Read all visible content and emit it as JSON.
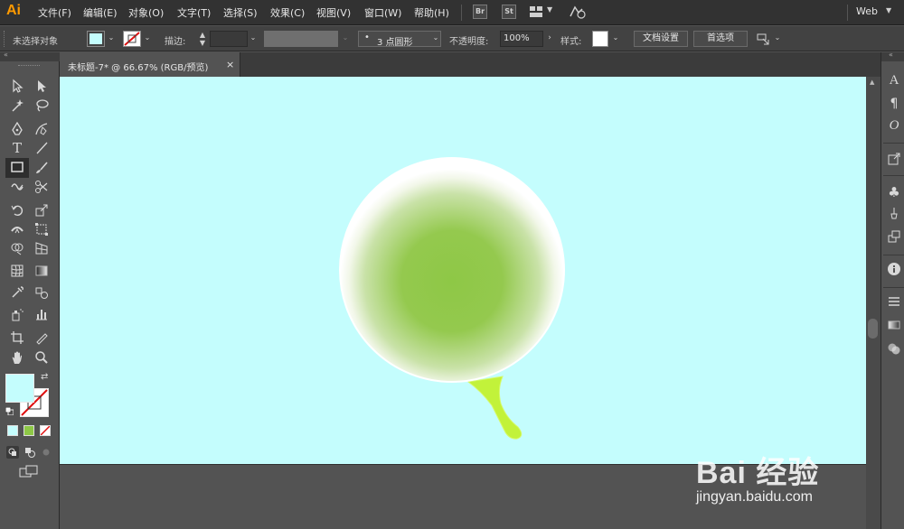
{
  "app": {
    "logo": "Ai",
    "workspace": "Web"
  },
  "menu": [
    {
      "label": "文件(F)"
    },
    {
      "label": "编辑(E)"
    },
    {
      "label": "对象(O)"
    },
    {
      "label": "文字(T)"
    },
    {
      "label": "选择(S)"
    },
    {
      "label": "效果(C)"
    },
    {
      "label": "视图(V)"
    },
    {
      "label": "窗口(W)"
    },
    {
      "label": "帮助(H)"
    }
  ],
  "app_buttons": {
    "bridge": "Br",
    "stock": "St"
  },
  "control": {
    "selection_status": "未选择对象",
    "stroke_label": "描边",
    "brush_label": "3 点圆形",
    "opacity_label": "不透明度",
    "opacity_value": "100%",
    "style_label": "样式",
    "doc_setup_button": "文档设置",
    "prefs_button": "首选项"
  },
  "document_tab": {
    "title": "未标题-7* @ 66.67% (RGB/预览)",
    "close": "×"
  },
  "colors": {
    "artboard": "#c4fdfd",
    "fill_swatch": "#c4fdfd",
    "balloon_center": "#8ec846",
    "tail": "#c2f23a"
  },
  "watermark": {
    "brand": "Bai 经验",
    "url": "jingyan.baidu.com"
  }
}
